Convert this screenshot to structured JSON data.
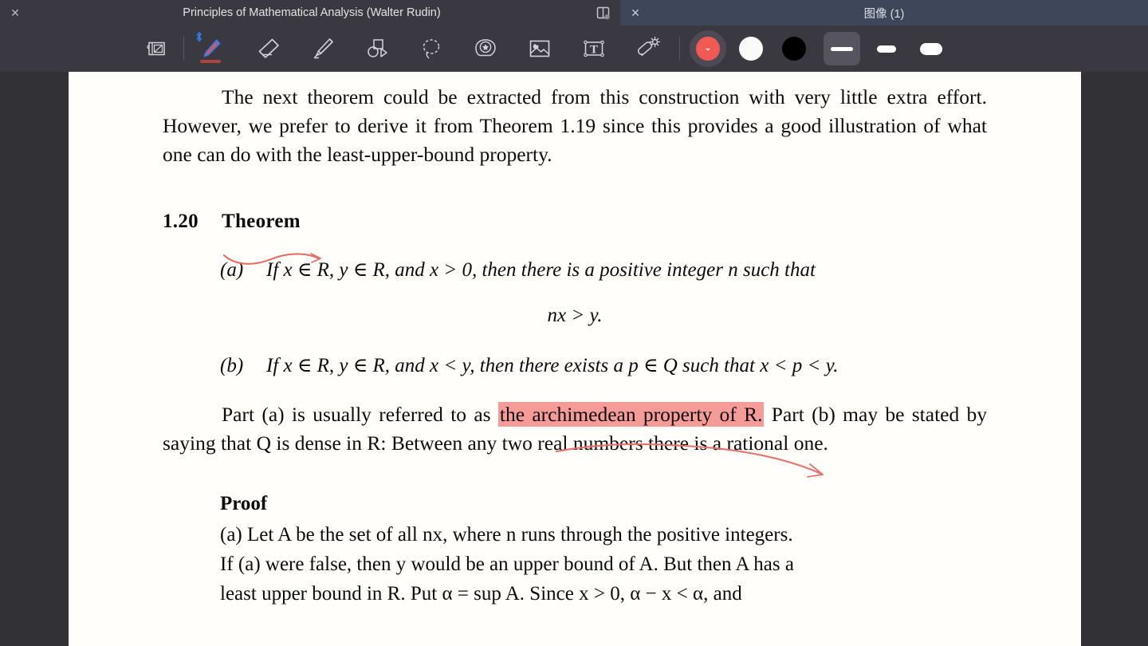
{
  "window": {
    "tabs": [
      {
        "title": "Principles of Mathematical Analysis (Walter Rudin)",
        "close_label": "✕",
        "active": true
      },
      {
        "title": "图像 (1)",
        "close_label": "✕",
        "active": false
      }
    ],
    "split_view_icon": "split-view-icon"
  },
  "toolbar": {
    "tools": [
      {
        "name": "page-layout-icon",
        "label": "Page layout"
      },
      {
        "name": "pen-icon",
        "label": "Pen",
        "selected": true,
        "bluetooth": "ᛦ"
      },
      {
        "name": "eraser-icon",
        "label": "Eraser"
      },
      {
        "name": "highlighter-icon",
        "label": "Highlighter"
      },
      {
        "name": "shapes-icon",
        "label": "Shapes"
      },
      {
        "name": "lasso-select-icon",
        "label": "Lasso select"
      },
      {
        "name": "sticker-icon",
        "label": "Sticker"
      },
      {
        "name": "insert-image-icon",
        "label": "Insert image"
      },
      {
        "name": "text-box-icon",
        "label": "Text box"
      },
      {
        "name": "magic-wand-icon",
        "label": "Magic wand"
      }
    ],
    "colors": [
      {
        "name": "color-red",
        "hex": "#F05A52",
        "selected": true,
        "chevron": "⌄"
      },
      {
        "name": "color-white",
        "hex": "#FAFAFA",
        "selected": false
      },
      {
        "name": "color-black",
        "hex": "#000000",
        "selected": false
      }
    ],
    "strokes": [
      {
        "name": "stroke-thin",
        "selected": true
      },
      {
        "name": "stroke-medium",
        "selected": false
      },
      {
        "name": "stroke-thick",
        "selected": false
      }
    ]
  },
  "document": {
    "paragraph_1": "The next theorem could be extracted from this construction with very little extra effort. However, we prefer to derive it from Theorem 1.19 since this provides a good illustration of what one can do with the least-upper-bound property.",
    "theorem": {
      "number": "1.20",
      "word": "Theorem",
      "items": [
        {
          "label": "(a)",
          "text_prefix": "If x ∈ R, y ∈ R, and x > 0,",
          "text": "If x ∈ R, y ∈ R, and x > 0, then there is a positive integer n such that"
        },
        {
          "label": "(b)",
          "text": "If x ∈ R, y ∈ R, and x < y, then there exists a p ∈ Q such that x < p < y."
        }
      ],
      "equation": "nx > y."
    },
    "paragraph_2": {
      "before": "Part (a) is usually referred to as ",
      "highlight": "the archimedean property of R.",
      "highlight_plain": "the archimedean property of R.",
      "after": "  Part (b) may be stated by saying that Q is dense in R: Between any two real numbers there is a rational one."
    },
    "proof": {
      "heading": "Proof",
      "lines": [
        "(a)   Let A be the set of all nx, where n runs through the positive integers.",
        "If (a) were false, then y would be an upper bound of A.  But then A has a",
        "least  upper  bound  in  R.   Put  α = sup A.   Since  x > 0,  α − x < α,  and"
      ]
    }
  },
  "annotations": {
    "theorem_underline": {
      "name": "red-squiggle-underline",
      "color": "#E8665E"
    },
    "highlight_color": "#F79B99",
    "highlight_curve": {
      "name": "red-curve-annotation",
      "color": "#E8726B"
    }
  }
}
